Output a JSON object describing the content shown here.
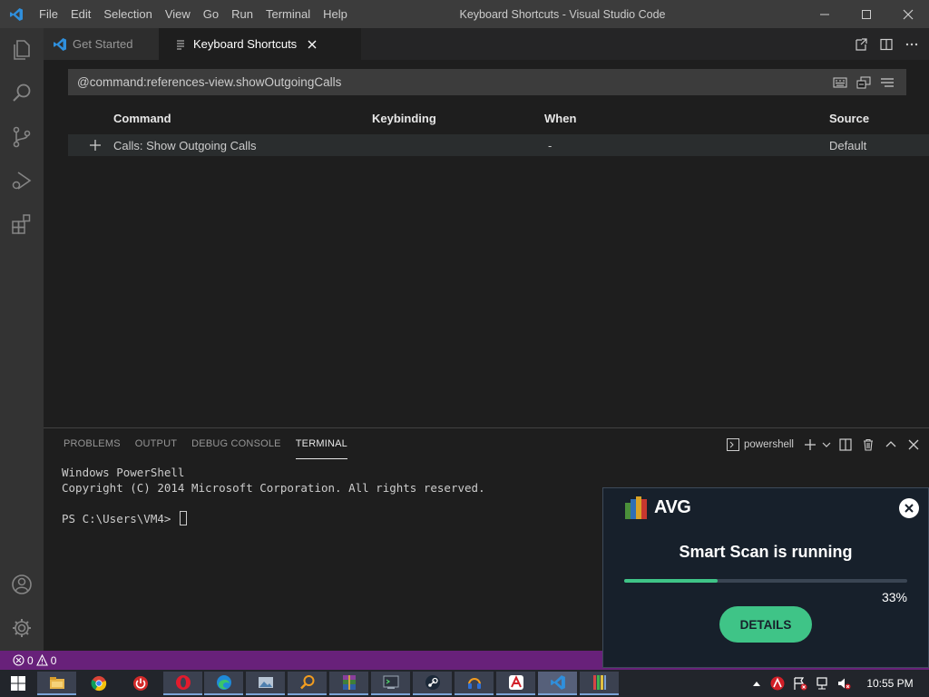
{
  "window": {
    "title": "Keyboard Shortcuts - Visual Studio Code",
    "menu": [
      "File",
      "Edit",
      "Selection",
      "View",
      "Go",
      "Run",
      "Terminal",
      "Help"
    ]
  },
  "tabs": [
    {
      "label": "Get Started"
    },
    {
      "label": "Keyboard Shortcuts"
    }
  ],
  "keybindings": {
    "search_value": "@command:references-view.showOutgoingCalls",
    "columns": {
      "command": "Command",
      "keybinding": "Keybinding",
      "when": "When",
      "source": "Source"
    },
    "rows": [
      {
        "command": "Calls: Show Outgoing Calls",
        "keybinding": "",
        "when": "-",
        "source": "Default"
      }
    ]
  },
  "panel": {
    "tabs": [
      "PROBLEMS",
      "OUTPUT",
      "DEBUG CONSOLE",
      "TERMINAL"
    ],
    "active_tab": "TERMINAL",
    "shell": "powershell",
    "terminal_lines": [
      "Windows PowerShell",
      "Copyright (C) 2014 Microsoft Corporation. All rights reserved.",
      "",
      "PS C:\\Users\\VM4> "
    ]
  },
  "statusbar": {
    "errors": "0",
    "warnings": "0",
    "color": "#68217a"
  },
  "avg": {
    "brand": "AVG",
    "heading": "Smart Scan is running",
    "progress_percent": 33,
    "progress_label": "33%",
    "button": "DETAILS",
    "accent": "#3fc487"
  },
  "taskbar": {
    "clock": "10:55 PM",
    "apps": [
      "file-explorer-icon",
      "chrome-icon",
      "power-app-icon",
      "opera-icon",
      "edge-icon",
      "photos-icon",
      "search-tool-icon",
      "winrar-icon",
      "terminal-app-icon",
      "steam-icon",
      "headphones-app-icon",
      "avira-icon",
      "vscode-icon",
      "notepad-icon"
    ]
  }
}
